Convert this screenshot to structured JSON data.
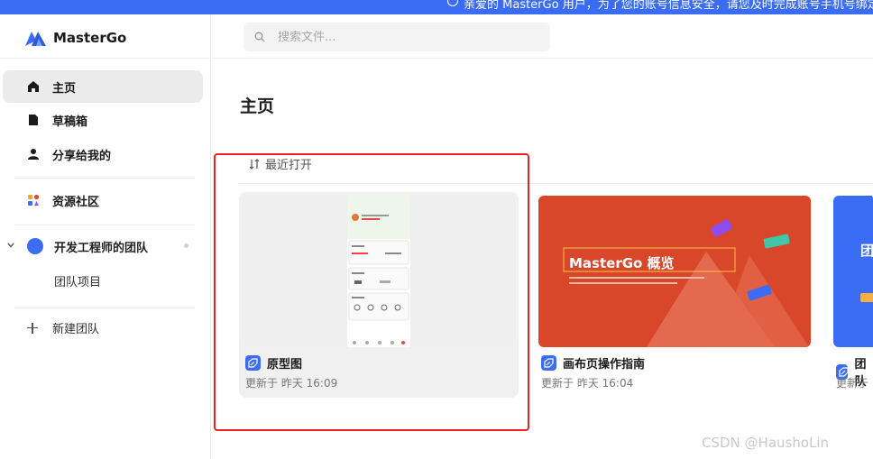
{
  "banner": {
    "text": "亲爱的 MasterGo 用户，为了您的账号信息安全，请您及时完成账号手机号绑定"
  },
  "app": {
    "name": "MasterGo"
  },
  "sidebar": {
    "items": [
      {
        "label": "主页",
        "icon": "home-icon",
        "active": true
      },
      {
        "label": "草稿箱",
        "icon": "draft-icon"
      },
      {
        "label": "分享给我的",
        "icon": "user-icon"
      },
      {
        "label": "资源社区",
        "icon": "community-icon"
      }
    ],
    "team": {
      "name": "开发工程师的团队",
      "avatar_color": "#3b6cf6",
      "sub_items": [
        "团队项目"
      ]
    },
    "new_team_label": "新建团队"
  },
  "search": {
    "placeholder": "搜索文件..."
  },
  "main": {
    "title": "主页",
    "sort_label": "最近打开",
    "files": [
      {
        "title": "原型图",
        "meta": "更新于 昨天 16:09",
        "thumb": "prototype"
      },
      {
        "title": "画布页操作指南",
        "meta": "更新于 昨天 16:04",
        "thumb": "overview",
        "thumb_title": "MasterGo 概览"
      },
      {
        "title": "团队",
        "meta": "更新于",
        "thumb": "team",
        "thumb_title": "团队"
      }
    ]
  },
  "colors": {
    "accent": "#3b6cf6",
    "selection": "#e8231f",
    "overview_bg": "#d9472b"
  },
  "watermark": "CSDN @HaushoLin"
}
